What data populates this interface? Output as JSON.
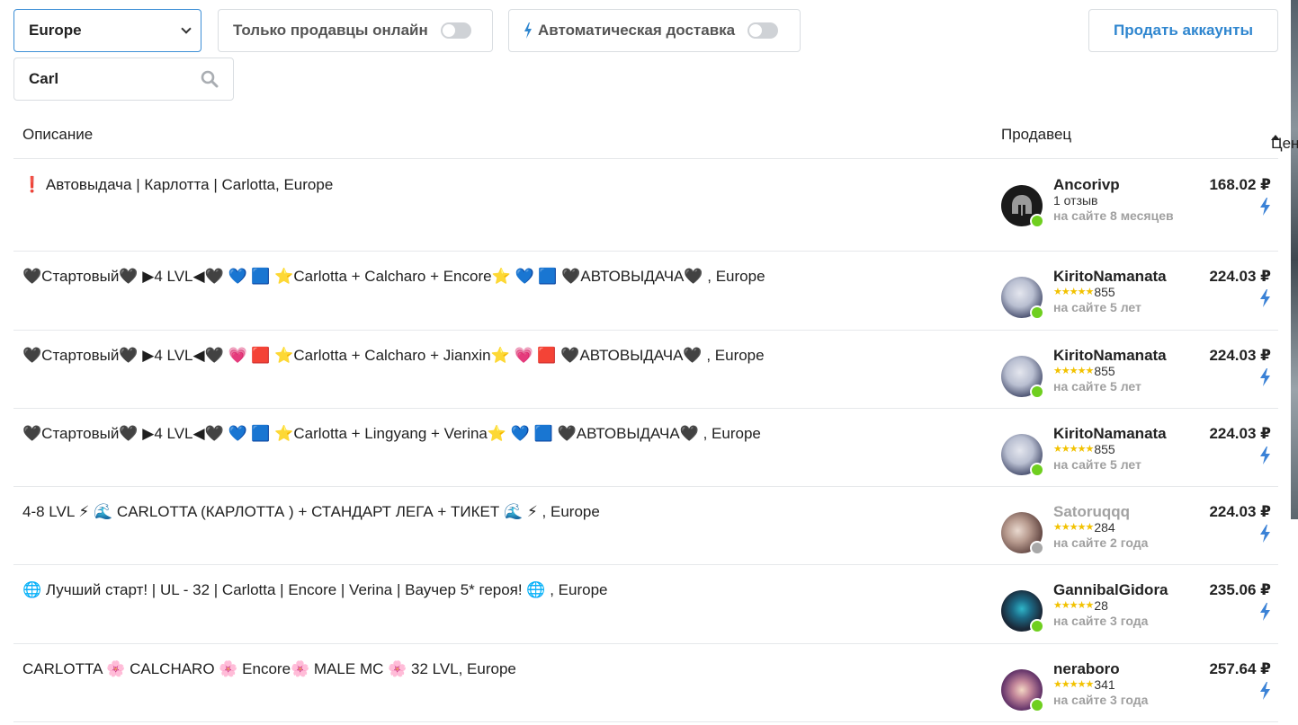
{
  "filters": {
    "region": "Europe",
    "online_only_label": "Только продавцы онлайн",
    "auto_delivery_label": "Автоматическая доставка",
    "sell_button": "Продать аккаунты",
    "search_value": "Carl"
  },
  "columns": {
    "description": "Описание",
    "seller": "Продавец",
    "price": "Цена"
  },
  "colors": {
    "accent": "#2f86cf",
    "online": "#6fcf1f",
    "offline": "#a8a8a8",
    "stars": "#f2c200"
  },
  "rows": [
    {
      "description": "❗ Автовыдача | Карлотта | Carlotta, Europe",
      "seller": "Ancorivp",
      "reviews": "1 отзыв",
      "age": "на сайте 8 месяцев",
      "price": "168.02 ₽",
      "online": true
    },
    {
      "description": "🖤Стартовый🖤 ▶4 LVL◀🖤 💙 🟦 ⭐Carlotta + Calcharo + Encore⭐ 💙 🟦 🖤АВТОВЫДАЧА🖤 , Europe",
      "seller": "KiritoNamanata",
      "stars": "★★★★★",
      "rating_count": "855",
      "age": "на сайте 5 лет",
      "price": "224.03 ₽",
      "online": true
    },
    {
      "description": "🖤Стартовый🖤 ▶4 LVL◀🖤 💗 🟥 ⭐Carlotta + Calcharo + Jianxin⭐ 💗 🟥 🖤АВТОВЫДАЧА🖤 , Europe",
      "seller": "KiritoNamanata",
      "stars": "★★★★★",
      "rating_count": "855",
      "age": "на сайте 5 лет",
      "price": "224.03 ₽",
      "online": true
    },
    {
      "description": "🖤Стартовый🖤 ▶4 LVL◀🖤 💙 🟦 ⭐Carlotta + Lingyang + Verina⭐ 💙 🟦 🖤АВТОВЫДАЧА🖤 , Europe",
      "seller": "KiritoNamanata",
      "stars": "★★★★★",
      "rating_count": "855",
      "age": "на сайте 5 лет",
      "price": "224.03 ₽",
      "online": true
    },
    {
      "description": "4-8 LVL ⚡ 🌊 CARLOTTA (КАРЛОТТА ) + СТАНДАРТ ЛЕГА + ТИКЕТ 🌊 ⚡ , Europe",
      "seller": "Satoruqqq",
      "stars": "★★★★★",
      "rating_count": "284",
      "age": "на сайте 2 года",
      "price": "224.03 ₽",
      "online": false
    },
    {
      "description": "🌐 Лучший старт! | UL - 32 | Carlotta | Encore | Verina | Ваучер 5* героя! 🌐 , Europe",
      "seller": "GannibalGidora",
      "stars": "★★★★★",
      "rating_count": "28",
      "age": "на сайте 3 года",
      "price": "235.06 ₽",
      "online": true
    },
    {
      "description": "CARLOTTA 🌸 CALCHARO 🌸 Encore🌸 MALE MC 🌸 32 LVL, Europe",
      "seller": "neraboro",
      "stars": "★★★★★",
      "rating_count": "341",
      "age": "на сайте 3 года",
      "price": "257.64 ₽",
      "online": true
    }
  ]
}
